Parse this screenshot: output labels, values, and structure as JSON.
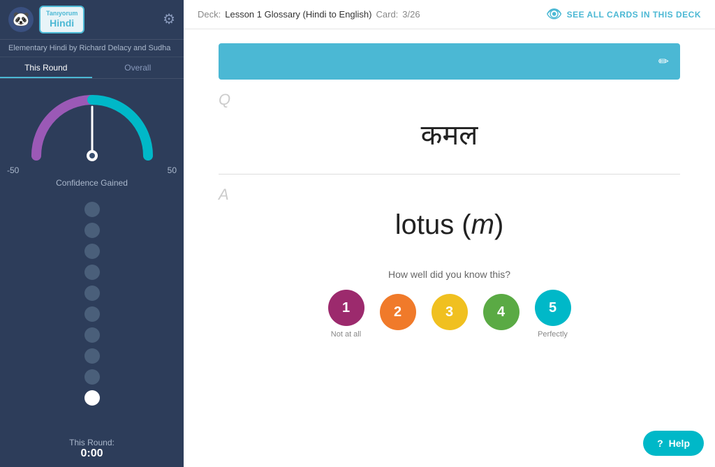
{
  "sidebar": {
    "logo_emoji": "🐼",
    "deck_badge_top": "Tanıyorum",
    "deck_badge_lang": "Hindi",
    "gear_symbol": "⚙",
    "book_title": "Elementary Hindi by Richard Delacy and Sudha",
    "tabs": [
      {
        "id": "this-round",
        "label": "This Round",
        "active": true
      },
      {
        "id": "overall",
        "label": "Overall",
        "active": false
      }
    ],
    "gauge": {
      "min": "-50",
      "max": "50",
      "label": "Confidence Gained",
      "needle_angle": 0
    },
    "dots": [
      {
        "id": 1,
        "active": false
      },
      {
        "id": 2,
        "active": false
      },
      {
        "id": 3,
        "active": false
      },
      {
        "id": 4,
        "active": false
      },
      {
        "id": 5,
        "active": false
      },
      {
        "id": 6,
        "active": false
      },
      {
        "id": 7,
        "active": false
      },
      {
        "id": 8,
        "active": false
      },
      {
        "id": 9,
        "active": false
      },
      {
        "id": 10,
        "active": true
      }
    ],
    "round_label": "This Round:",
    "round_time": "0:00"
  },
  "topbar": {
    "deck_label": "Deck:",
    "deck_name": "Lesson 1 Glossary (Hindi to English)",
    "card_label": "Card:",
    "card_count": "3/26",
    "see_all_label": "SEE ALL CARDS IN THIS DECK",
    "see_all_icon": "👁"
  },
  "card": {
    "q_label": "Q",
    "question": "कमल",
    "a_label": "A",
    "answer": "lotus (m)"
  },
  "rating": {
    "prompt": "How well did you know this?",
    "buttons": [
      {
        "value": 1,
        "label": "Not at all",
        "class": "r1"
      },
      {
        "value": 2,
        "label": "",
        "class": "r2"
      },
      {
        "value": 3,
        "label": "",
        "class": "r3"
      },
      {
        "value": 4,
        "label": "",
        "class": "r4"
      },
      {
        "value": 5,
        "label": "Perfectly",
        "class": "r5"
      }
    ]
  },
  "help": {
    "label": "Help"
  }
}
